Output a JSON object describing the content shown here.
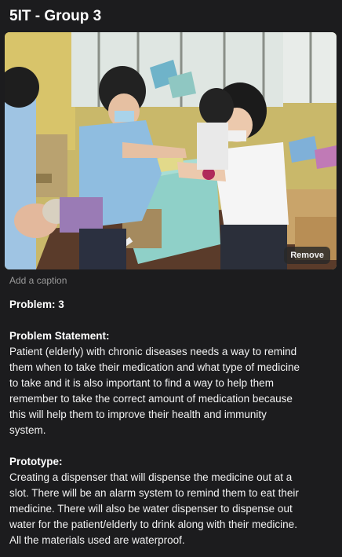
{
  "post": {
    "title": "5IT - Group 3",
    "remove_label": "Remove",
    "caption_placeholder": "Add a caption",
    "problem": "Problem: 3",
    "problem_statement_heading": "Problem Statement:",
    "problem_statement_lines": [
      "Patient (elderly) with chronic diseases needs a way to remind",
      "them when to take their medication and what type of medicine",
      "to take and it is also important to find a way to help them",
      "remember to take the correct amount of medication because",
      "this will help them to improve their health and immunity",
      "system."
    ],
    "prototype_heading": "Prototype:",
    "prototype_lines": [
      "Creating a dispenser that will dispense the medicine out at a",
      "slot. There will be an alarm system to remind them to eat their",
      "medicine. There will also be water dispenser to dispense out",
      "water for the patient/elderly to drink along with their medicine.",
      "All the materials used are waterproof."
    ]
  },
  "colors": {
    "background": "#1c1c1e",
    "text": "#f2f2f2",
    "caption": "#9a9a9a"
  }
}
